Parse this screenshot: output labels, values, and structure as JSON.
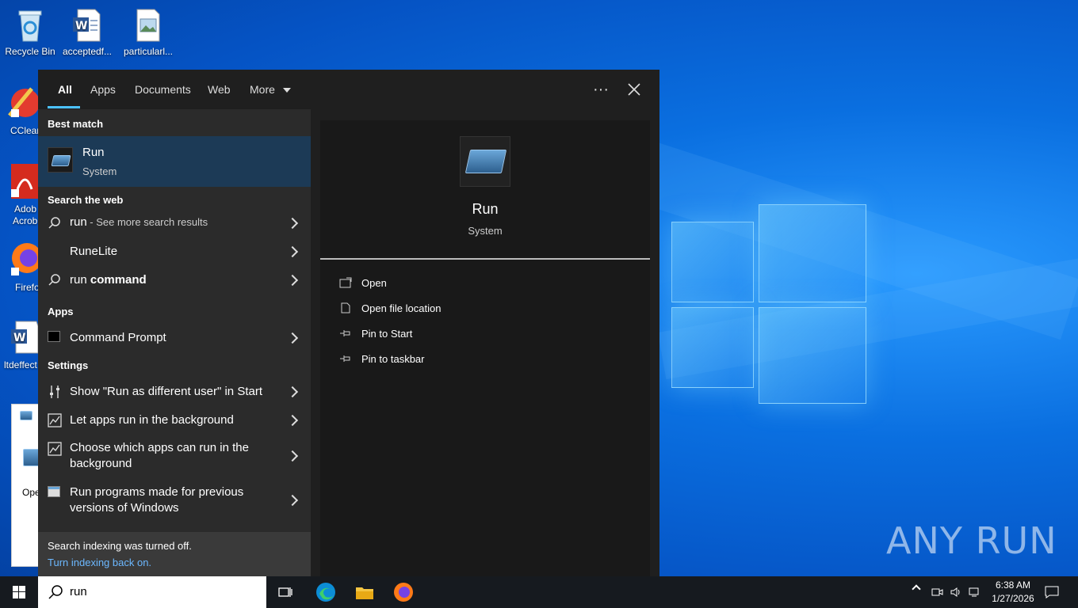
{
  "desktop": {
    "icons": [
      {
        "label": "Recycle Bin"
      },
      {
        "label": "acceptedf..."
      },
      {
        "label": "particularl..."
      }
    ],
    "left_partial": [
      {
        "label": "CClear"
      },
      {
        "label": "Adob"
      },
      {
        "label": "Acrob"
      },
      {
        "label": "Firefo"
      },
      {
        "label": "ltdeffect"
      },
      {
        "label": "Ope"
      }
    ]
  },
  "search_panel": {
    "tabs": [
      {
        "label": "All"
      },
      {
        "label": "Apps"
      },
      {
        "label": "Documents"
      },
      {
        "label": "Web"
      },
      {
        "label": "More"
      }
    ],
    "sections": {
      "best_match": "Best match",
      "search_web": "Search the web",
      "apps": "Apps",
      "settings": "Settings"
    },
    "best_match": {
      "title": "Run",
      "subtitle": "System"
    },
    "web_results": [
      {
        "query": "run",
        "suffix": " - See more search results"
      },
      {
        "label": "RuneLite"
      },
      {
        "query": "run",
        "bold": " command"
      }
    ],
    "apps": [
      {
        "label": "Command Prompt"
      }
    ],
    "settings": [
      {
        "label": "Show \"Run as different user\" in Start"
      },
      {
        "label": "Let apps run in the background"
      },
      {
        "label": "Choose which apps can run in the background"
      },
      {
        "label": "Run programs made for previous versions of Windows"
      }
    ],
    "footer": {
      "line1": "Search indexing was turned off.",
      "line2": "Turn indexing back on."
    },
    "preview": {
      "title": "Run",
      "subtitle": "System",
      "actions": [
        {
          "label": "Open",
          "icon": "open-icon"
        },
        {
          "label": "Open file location",
          "icon": "file-location-icon"
        },
        {
          "label": "Pin to Start",
          "icon": "pin-icon"
        },
        {
          "label": "Pin to taskbar",
          "icon": "pin-icon"
        }
      ]
    }
  },
  "taskbar": {
    "search_value": "run",
    "time": "6:38 AM",
    "date": "1/27/2026"
  },
  "watermark": "ANY RUN",
  "colors": {
    "accent": "#4cc2ff",
    "selected": "#1c3a56",
    "link": "#6cb8ff"
  }
}
